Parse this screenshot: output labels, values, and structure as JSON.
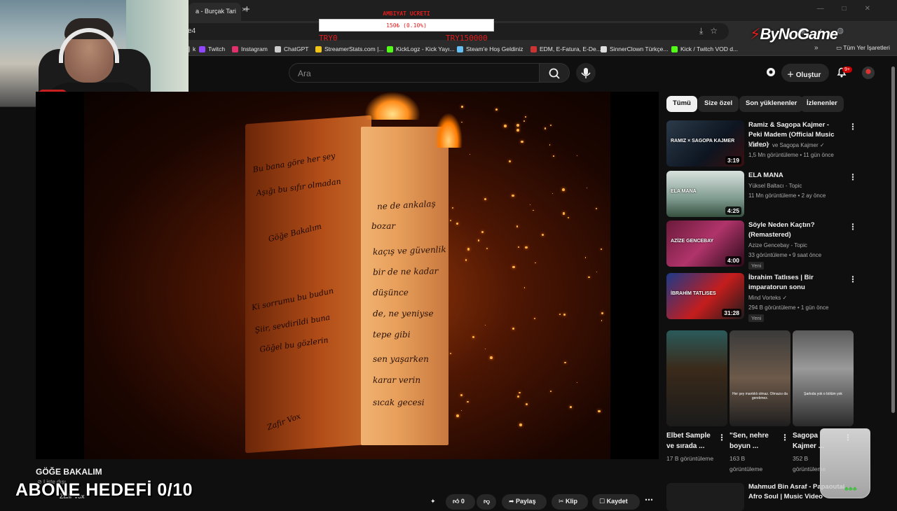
{
  "browser": {
    "tabs": [
      {
        "label": "a - Burçak Tari"
      }
    ],
    "new_tab": "+",
    "tab_close": "×",
    "window_controls": "—□✕",
    "url": "e4",
    "url_actions": "⤓☆",
    "extensions": "◉ ◐ ◍",
    "bookmarks": [
      {
        "label": "k",
        "color": "#8d8d8d"
      },
      {
        "label": "Twitch",
        "color": "#9146ff"
      },
      {
        "label": "Instagram",
        "color": "#e1306c"
      },
      {
        "label": "ChatGPT",
        "color": "#cccccc"
      },
      {
        "label": "StreamerStats.com |...",
        "color": "#f0c419"
      },
      {
        "label": "KickLogz - Kick Yayı...",
        "color": "#53fc18"
      },
      {
        "label": "Steam'e Hoş Geldiniz",
        "color": "#66c0f4"
      },
      {
        "label": "EDM, E-Fatura, E-De...",
        "color": "#cc3333"
      },
      {
        "label": "SinnerClown Türkçe...",
        "color": "#dddddd"
      },
      {
        "label": "Kick / Twitch VOD d...",
        "color": "#53fc18"
      }
    ],
    "bookmarks_more": "»",
    "bookmarks_all": "Tüm Yer İşaretleri"
  },
  "overlay": {
    "donation_title": "AMBIYAT UCRETI",
    "donation_progress": "150₺ (0.10%)",
    "donation_min": "TRY0",
    "donation_max": "TRY150000",
    "brand": "ByNoGame",
    "brand_mark": "⚡",
    "subscriber_goal": "ABONE HEDEFİ 0/10"
  },
  "youtube": {
    "search_placeholder": "Ara",
    "create_label": "Oluştur",
    "notif_count": "9+",
    "chips": [
      {
        "label": "Tümü",
        "active": true
      },
      {
        "label": "Size özel",
        "active": false
      },
      {
        "label": "Son yüklenenler",
        "active": false
      },
      {
        "label": "İzlenenler",
        "active": false
      }
    ],
    "video": {
      "title": "GÖĞE BAKALIM",
      "subtitle": "Liste dışı",
      "channel_line": "Zafir Vox",
      "script_lines": [
        "Bu bana göre her şey",
        "Aşığı bu sıfır olmadan",
        "Göğe Bakalım",
        "Ki sorrumu bu budun",
        "Şiir, sevdirildi buna",
        "Göğel bu gözlerin",
        "ne de ankalaş",
        "bozar",
        "kaçış ve güvenlik",
        "bir de ne kadar",
        "düşünce",
        "de, ne yeniyse",
        "tepe gibi",
        "sen yaşarken",
        "karar verin",
        "sıcak gecesi",
        "Zafir Vox"
      ],
      "likes": "0",
      "share": "Paylaş",
      "clip": "Klip",
      "save": "Kaydet",
      "more": "⋯"
    },
    "recommendations": [
      {
        "title": "Ramiz & Sagopa Kajmer - Peki Madem (Official Music Video)",
        "channel": "Ramiz ✓ ve Sagopa Kajmer ✓",
        "meta": "1,5 Mn görüntüleme • 11 gün önce",
        "duration": "3:19",
        "new": ""
      },
      {
        "title": "ELA MANA",
        "channel": "Yüksel Baltacı - Topic",
        "meta": "11 Mn görüntüleme • 2 ay önce",
        "duration": "4:25",
        "new": ""
      },
      {
        "title": "Söyle Neden Kaçtın? (Remastered)",
        "channel": "Azize Gencebay - Topic",
        "meta": "33 görüntüleme • 9 saat önce",
        "duration": "4:00",
        "new": "Yeni"
      },
      {
        "title": "İbrahim Tatlıses | Bir imparatorun sonu",
        "channel": "Mind Vorteks ✓",
        "meta": "294 B görüntüleme • 1 gün önce",
        "duration": "31:28",
        "new": "Yeni"
      }
    ],
    "rec_thumb_texts": [
      "RAMIZ × SAGOPA KAJMER",
      "ELA MANA",
      "AZİZE GENCEBAY",
      "İBRAHİM TATLISES"
    ],
    "shorts": [
      {
        "title": "Elbet Sample ve sırada ...",
        "views": "17 B görüntüleme",
        "caption": ""
      },
      {
        "title": "\"Sen, nehre boyun ...",
        "views": "163 B görüntüleme",
        "caption": "Her şey mantıklı olmaz. Olmazsı da gerekmez."
      },
      {
        "title": "Sagopa Kajmer ...",
        "views": "352 B görüntüleme",
        "caption": "Şarkıda yok o bölüm yok"
      }
    ],
    "last_rec_title": "Mahmud Bin Asraf - Papaoutai Afro Soul | Music Video",
    "glass_leaves": "♣♣♣"
  }
}
